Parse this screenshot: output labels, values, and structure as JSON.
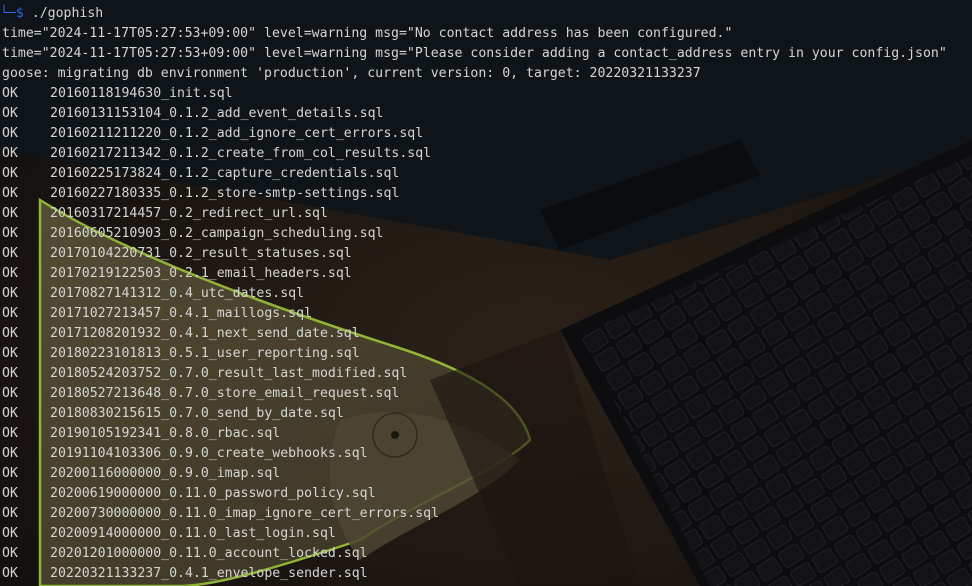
{
  "terminal": {
    "prompt_symbol": "└─$",
    "command": " ./gophish",
    "log_lines": [
      "time=\"2024-11-17T05:27:53+09:00\" level=warning msg=\"No contact address has been configured.\"",
      "time=\"2024-11-17T05:27:53+09:00\" level=warning msg=\"Please consider adding a contact_address entry in your config.json\"",
      "goose: migrating db environment 'production', current version: 0, target: 20220321133237"
    ],
    "status_ok": "OK",
    "migrations": [
      "20160118194630_init.sql",
      "20160131153104_0.1.2_add_event_details.sql",
      "20160211211220_0.1.2_add_ignore_cert_errors.sql",
      "20160217211342_0.1.2_create_from_col_results.sql",
      "20160225173824_0.1.2_capture_credentials.sql",
      "20160227180335_0.1.2_store-smtp-settings.sql",
      "20160317214457_0.2_redirect_url.sql",
      "20160605210903_0.2_campaign_scheduling.sql",
      "20170104220731_0.2_result_statuses.sql",
      "20170219122503_0.2.1_email_headers.sql",
      "20170827141312_0.4_utc_dates.sql",
      "20171027213457_0.4.1_maillogs.sql",
      "20171208201932_0.4.1_next_send_date.sql",
      "20180223101813_0.5.1_user_reporting.sql",
      "20180524203752_0.7.0_result_last_modified.sql",
      "20180527213648_0.7.0_store_email_request.sql",
      "20180830215615_0.7.0_send_by_date.sql",
      "20190105192341_0.8.0_rbac.sql",
      "20191104103306_0.9.0_create_webhooks.sql",
      "20200116000000_0.9.0_imap.sql",
      "20200619000000_0.11.0_password_policy.sql",
      "20200730000000_0.11.0_imap_ignore_cert_errors.sql",
      "20200914000000_0.11.0_last_login.sql",
      "20201201000000_0.11.0_account_locked.sql",
      "20220321133237_0.4.1_envelope_sender.sql"
    ]
  }
}
